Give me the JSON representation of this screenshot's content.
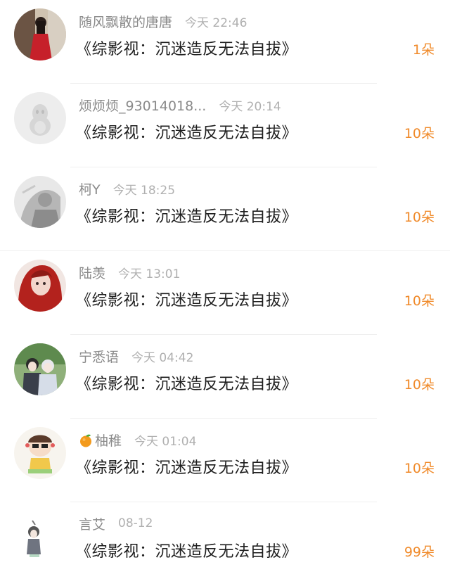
{
  "entries": [
    {
      "name": "随风飘散的唐唐",
      "time": "今天 22:46",
      "title": "《综影视：沉迷造反无法自拔》",
      "gift": "1朵",
      "avatar": "avatar-girl-red-dress"
    },
    {
      "name": "烦烦烦_93014018...",
      "time": "今天 20:14",
      "title": "《综影视：沉迷造反无法自拔》",
      "gift": "10朵",
      "avatar": "default-penguin-avatar"
    },
    {
      "name": "柯Y",
      "time": "今天 18:25",
      "title": "《综影视：沉迷造反无法自拔》",
      "gift": "10朵",
      "avatar": "avatar-gray-sketch"
    },
    {
      "name": "陆羡",
      "time": "今天 13:01",
      "title": "《综影视：沉迷造反无法自拔》",
      "gift": "10朵",
      "avatar": "avatar-red-hair-girl"
    },
    {
      "name": "宁悉语",
      "time": "今天 04:42",
      "title": "《综影视：沉迷造反无法自拔》",
      "gift": "10朵",
      "avatar": "avatar-anime-couple"
    },
    {
      "name": "柚稚",
      "time": "今天 01:04",
      "title": "《综影视：沉迷造反无法自拔》",
      "gift": "10朵",
      "avatar": "avatar-cartoon-kid",
      "name_prefix_icon": "tangerine-icon"
    },
    {
      "name": "言艾",
      "time": "08-12",
      "title": "《综影视：沉迷造反无法自拔》",
      "gift": "99朵",
      "avatar": "avatar-chibi-sketch"
    }
  ],
  "colors": {
    "gift": "#f08a2a",
    "name": "#8a8a8a",
    "time": "#b0b0b0",
    "title": "#1e1e1e"
  }
}
